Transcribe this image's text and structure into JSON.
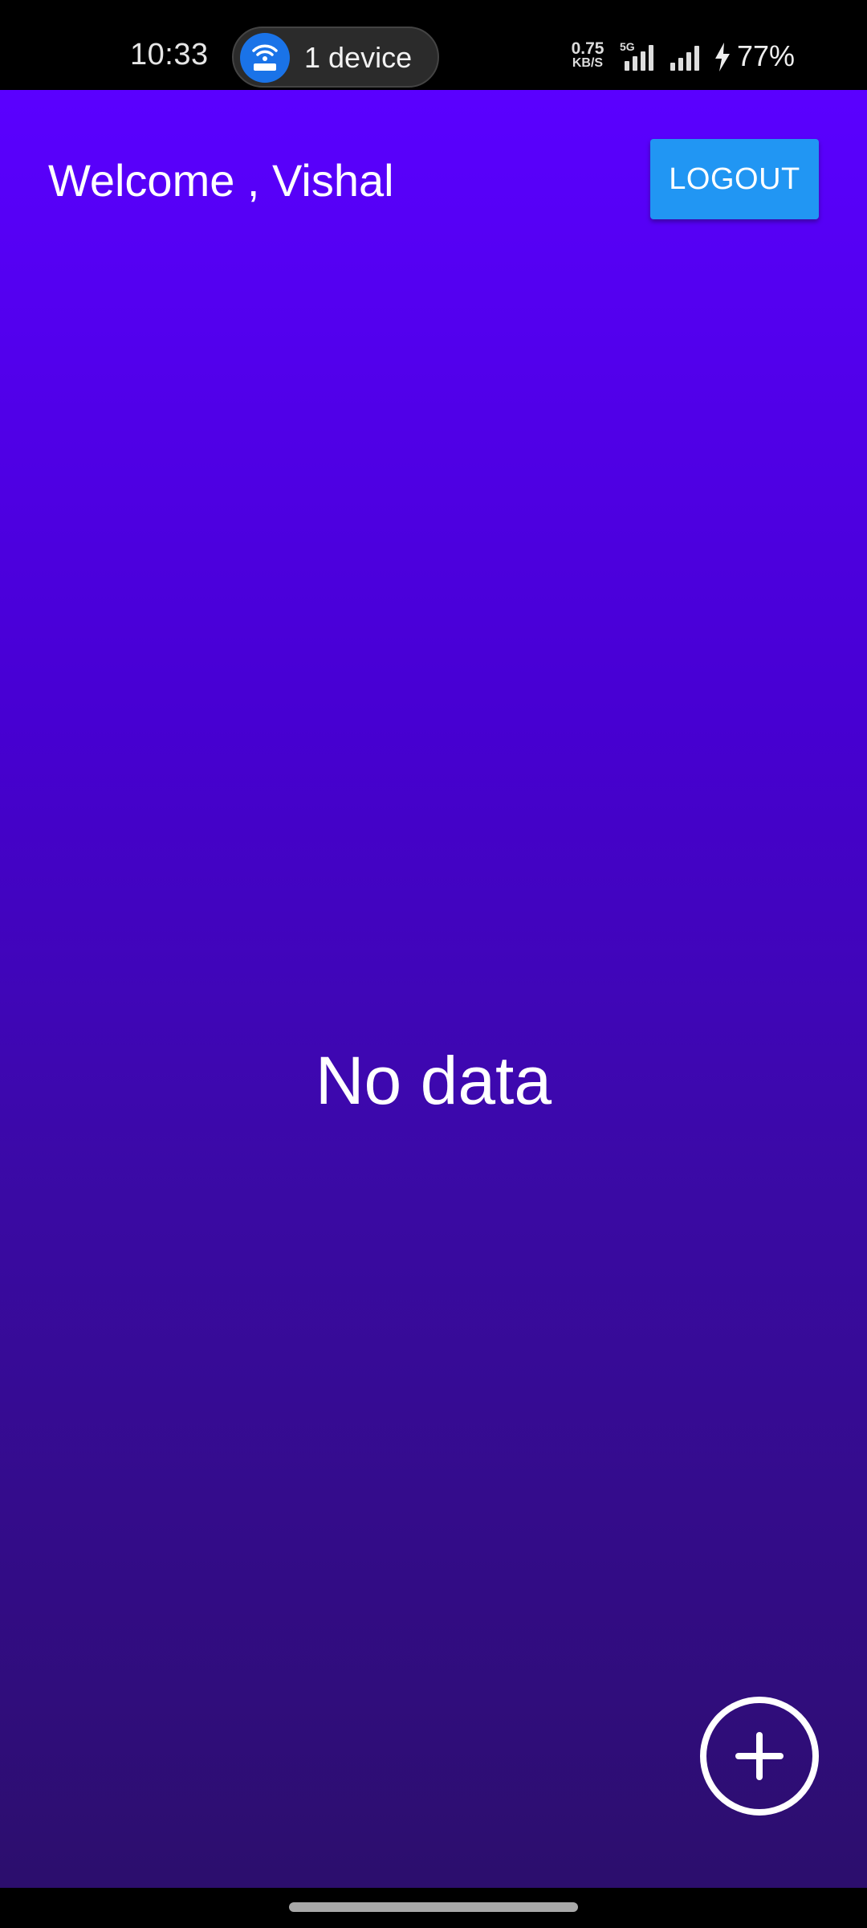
{
  "status_bar": {
    "time": "10:33",
    "hotspot_label": "1 device",
    "net_speed_value": "0.75",
    "net_speed_unit": "KB/S",
    "network_type": "5G",
    "battery": "77%",
    "icons": [
      "wifi-hotspot-icon",
      "signal-5g-icon",
      "signal-icon",
      "charging-bolt-icon"
    ]
  },
  "header": {
    "welcome_text": "Welcome , Vishal",
    "logout_label": "LOGOUT"
  },
  "main": {
    "empty_state": "No data"
  },
  "fab": {
    "icon": "add-icon"
  },
  "colors": {
    "gradient_top": "#5a00ff",
    "gradient_bottom": "#2c0e6d",
    "logout_button": "#2196f3",
    "hotspot_icon": "#1a73e8"
  }
}
